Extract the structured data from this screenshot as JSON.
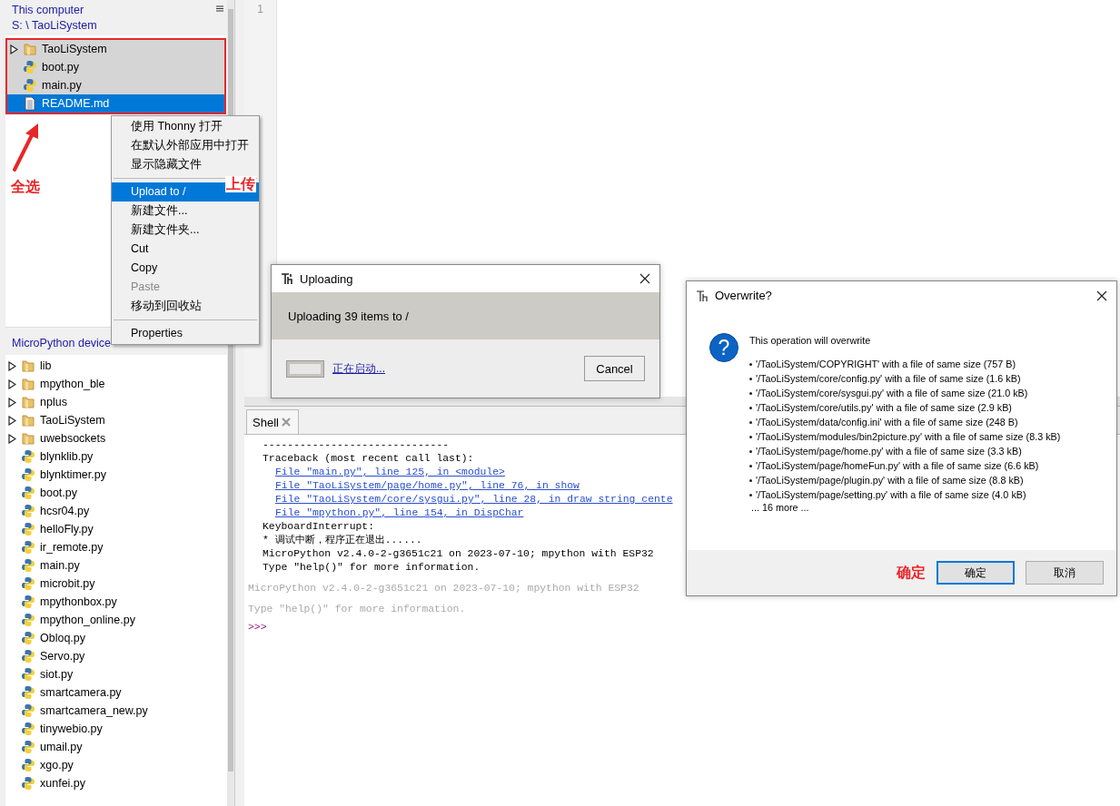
{
  "local_panel": {
    "title": "This computer",
    "path": "S: \\ TaoLiSystem",
    "items": [
      {
        "name": "TaoLiSystem",
        "kind": "folder",
        "selected": true,
        "focused": false
      },
      {
        "name": "boot.py",
        "kind": "python",
        "selected": true,
        "focused": false
      },
      {
        "name": "main.py",
        "kind": "python",
        "selected": true,
        "focused": false
      },
      {
        "name": "README.md",
        "kind": "text",
        "selected": true,
        "focused": true
      }
    ]
  },
  "device_panel": {
    "title": "MicroPython device",
    "items": [
      {
        "name": "lib",
        "kind": "folder",
        "selected": false
      },
      {
        "name": "mpython_ble",
        "kind": "folder",
        "selected": false
      },
      {
        "name": "nplus",
        "kind": "folder",
        "selected": false
      },
      {
        "name": "TaoLiSystem",
        "kind": "folder",
        "selected": false
      },
      {
        "name": "uwebsockets",
        "kind": "folder",
        "selected": false
      },
      {
        "name": "blynklib.py",
        "kind": "python",
        "selected": false
      },
      {
        "name": "blynktimer.py",
        "kind": "python",
        "selected": false
      },
      {
        "name": "boot.py",
        "kind": "python",
        "selected": false
      },
      {
        "name": "hcsr04.py",
        "kind": "python",
        "selected": false
      },
      {
        "name": "helloFly.py",
        "kind": "python",
        "selected": false
      },
      {
        "name": "ir_remote.py",
        "kind": "python",
        "selected": false
      },
      {
        "name": "main.py",
        "kind": "python",
        "selected": false
      },
      {
        "name": "microbit.py",
        "kind": "python",
        "selected": false
      },
      {
        "name": "mpythonbox.py",
        "kind": "python",
        "selected": false
      },
      {
        "name": "mpython_online.py",
        "kind": "python",
        "selected": false
      },
      {
        "name": "Obloq.py",
        "kind": "python",
        "selected": false
      },
      {
        "name": "Servo.py",
        "kind": "python",
        "selected": false
      },
      {
        "name": "siot.py",
        "kind": "python",
        "selected": false
      },
      {
        "name": "smartcamera.py",
        "kind": "python",
        "selected": false
      },
      {
        "name": "smartcamera_new.py",
        "kind": "python",
        "selected": false
      },
      {
        "name": "tinywebio.py",
        "kind": "python",
        "selected": false
      },
      {
        "name": "umail.py",
        "kind": "python",
        "selected": false
      },
      {
        "name": "xgo.py",
        "kind": "python",
        "selected": false
      },
      {
        "name": "xunfei.py",
        "kind": "python",
        "selected": false
      }
    ]
  },
  "context_menu": {
    "items": [
      {
        "kind": "item",
        "label": "使用 Thonny 打开",
        "selected": false,
        "disabled": false
      },
      {
        "kind": "item",
        "label": "在默认外部应用中打开",
        "selected": false,
        "disabled": false
      },
      {
        "kind": "item",
        "label": "显示隐藏文件",
        "selected": false,
        "disabled": false
      },
      {
        "kind": "separator"
      },
      {
        "kind": "item",
        "label": "Upload to /",
        "selected": true,
        "disabled": false
      },
      {
        "kind": "item",
        "label": "新建文件...",
        "selected": false,
        "disabled": false
      },
      {
        "kind": "item",
        "label": "新建文件夹...",
        "selected": false,
        "disabled": false
      },
      {
        "kind": "item",
        "label": "Cut",
        "selected": false,
        "disabled": false
      },
      {
        "kind": "item",
        "label": "Copy",
        "selected": false,
        "disabled": false
      },
      {
        "kind": "item",
        "label": "Paste",
        "selected": false,
        "disabled": true
      },
      {
        "kind": "item",
        "label": "移动到回收站",
        "selected": false,
        "disabled": false
      },
      {
        "kind": "separator"
      },
      {
        "kind": "item",
        "label": "Properties",
        "selected": false,
        "disabled": false
      }
    ]
  },
  "annotations": {
    "select_all": "全选",
    "upload": "上传",
    "confirm": "确定"
  },
  "editor": {
    "line_numbers": [
      "1"
    ]
  },
  "shell": {
    "tab": "Shell",
    "lines": [
      {
        "kind": "output",
        "text": "------------------------------"
      },
      {
        "kind": "output",
        "text": "Traceback (most recent call last):"
      },
      {
        "kind": "link",
        "text": "File \"main.py\", line 125, in <module>"
      },
      {
        "kind": "link",
        "text": "File \"TaoLiSystem/page/home.py\", line 76, in show"
      },
      {
        "kind": "link",
        "text": "File \"TaoLiSystem/core/sysgui.py\", line 28, in draw string cente"
      },
      {
        "kind": "link",
        "text": "File \"mpython.py\", line 154, in DispChar"
      },
      {
        "kind": "output",
        "text": "KeyboardInterrupt:"
      },
      {
        "kind": "output",
        "text": "* 调试中断，程序正在退出......"
      },
      {
        "kind": "output",
        "text": "MicroPython v2.4.0-2-g3651c21 on 2023-07-10; mpython with ESP32"
      },
      {
        "kind": "output",
        "text": "Type \"help()\" for more information."
      },
      {
        "kind": "dim",
        "text": "MicroPython v2.4.0-2-g3651c21 on 2023-07-10; mpython with ESP32"
      },
      {
        "kind": "dim",
        "text": "Type \"help()\" for more information."
      },
      {
        "kind": "prompt",
        "text": ">>>"
      }
    ]
  },
  "upload_dialog": {
    "title": "Uploading",
    "message": "Uploading 39 items to /",
    "level": 0,
    "status_link": "正在启动...",
    "cancel": "Cancel"
  },
  "overwrite_dialog": {
    "title": "Overwrite?",
    "icon": "?",
    "message": "This operation will overwrite",
    "files": [
      "'/TaoLiSystem/COPYRIGHT' with a file of same size (757 B)",
      "'/TaoLiSystem/core/config.py' with a file of same size (1.6 kB)",
      "'/TaoLiSystem/core/sysgui.py' with a file of same size (21.0 kB)",
      "'/TaoLiSystem/core/utils.py' with a file of same size (2.9 kB)",
      "'/TaoLiSystem/data/config.ini' with a file of same size (248 B)",
      "'/TaoLiSystem/modules/bin2picture.py' with a file of same size (8.3 kB)",
      "'/TaoLiSystem/page/home.py' with a file of same size (3.3 kB)",
      "'/TaoLiSystem/page/homeFun.py' with a file of same size (6.6 kB)",
      "'/TaoLiSystem/page/plugin.py' with a file of same size (8.8 kB)",
      "'/TaoLiSystem/page/setting.py' with a file of same size (4.0 kB)"
    ],
    "more": "... 16 more ...",
    "buttons": [
      {
        "label": "确定",
        "default": true
      },
      {
        "label": "取消",
        "default": false
      }
    ]
  }
}
